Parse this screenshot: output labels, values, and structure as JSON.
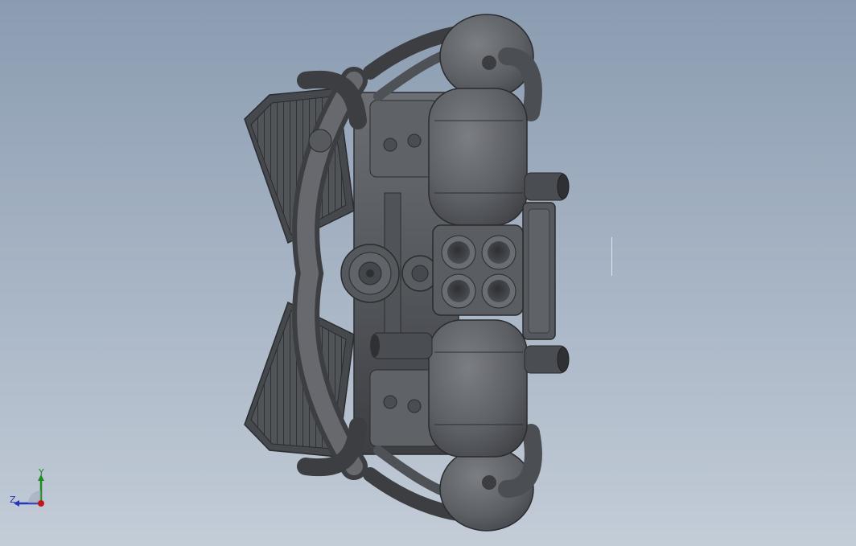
{
  "viewport": {
    "background_top": "#8b9cb1",
    "background_bottom": "#c3ccd7",
    "model": "boxer-engine-assembly",
    "render_style": "shaded-with-edges"
  },
  "triad": {
    "y_label": "Y",
    "z_label": "Z",
    "y_color": "#1d8a22",
    "z_color": "#2636b8",
    "x_color": "#c01818"
  }
}
